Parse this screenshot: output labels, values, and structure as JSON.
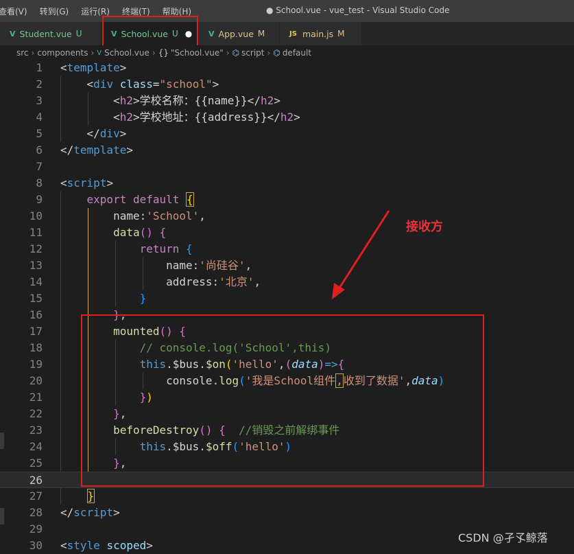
{
  "menu": [
    "查看(V)",
    "转到(G)",
    "运行(R)",
    "终端(T)",
    "帮助(H)"
  ],
  "window_title": "● School.vue - vue_test - Visual Studio Code",
  "tabs": [
    {
      "label": "Student.vue",
      "badge": "U",
      "icon": "V",
      "status": "untracked"
    },
    {
      "label": "School.vue",
      "badge": "U",
      "icon": "V",
      "status": "untracked",
      "active": true,
      "dirty": "●"
    },
    {
      "label": "App.vue",
      "badge": "M",
      "icon": "V",
      "status": "modified"
    },
    {
      "label": "main.js",
      "badge": "M",
      "icon": "JS",
      "status": "modified"
    }
  ],
  "breadcrumb": [
    "src",
    "components",
    "School.vue",
    "\"School.vue\"",
    "script",
    "default"
  ],
  "breadcrumb_icons": {
    "vue": "V",
    "braces": "{}",
    "cube": "⌬"
  },
  "code": {
    "line_numbers": [
      "1",
      "2",
      "3",
      "4",
      "5",
      "6",
      "7",
      "8",
      "9",
      "10",
      "11",
      "12",
      "13",
      "14",
      "15",
      "16",
      "17",
      "18",
      "19",
      "20",
      "21",
      "22",
      "23",
      "24",
      "25",
      "26",
      "27",
      "28",
      "29",
      "30"
    ],
    "l3_text": "学校名称：{{name}}",
    "l4_text": "学校地址：{{address}}",
    "l10_key": "name:",
    "l10_str": "'School'",
    "l13_key": "name:",
    "l13_str": "'尚硅谷'",
    "l14_key": "address:",
    "l14_str": "'北京'",
    "l18_comment": "// console.log('School',this)",
    "l19_bus": "$bus",
    "l19_on": "$on",
    "l19_str": "'hello'",
    "l19_param": "data",
    "l20_console": "console",
    "l20_log": "log",
    "l20_str1": "'我是School组件",
    "l20_comma": ",",
    "l20_str2": "收到了数据'",
    "l20_param": "data",
    "l23_fn": "beforeDestroy",
    "l23_comment": "//销毁之前解绑事件",
    "l24_off": "$off",
    "l24_str": "'hello'",
    "l30_tag": "style",
    "l30_attr": "scoped"
  },
  "annotation": {
    "label": "接收方"
  },
  "watermark": "CSDN @孑孓鲸落",
  "colors": {
    "annotation_red": "#e02020",
    "vue_green": "#41b883",
    "untracked": "#73c991",
    "modified": "#e2c08d"
  }
}
